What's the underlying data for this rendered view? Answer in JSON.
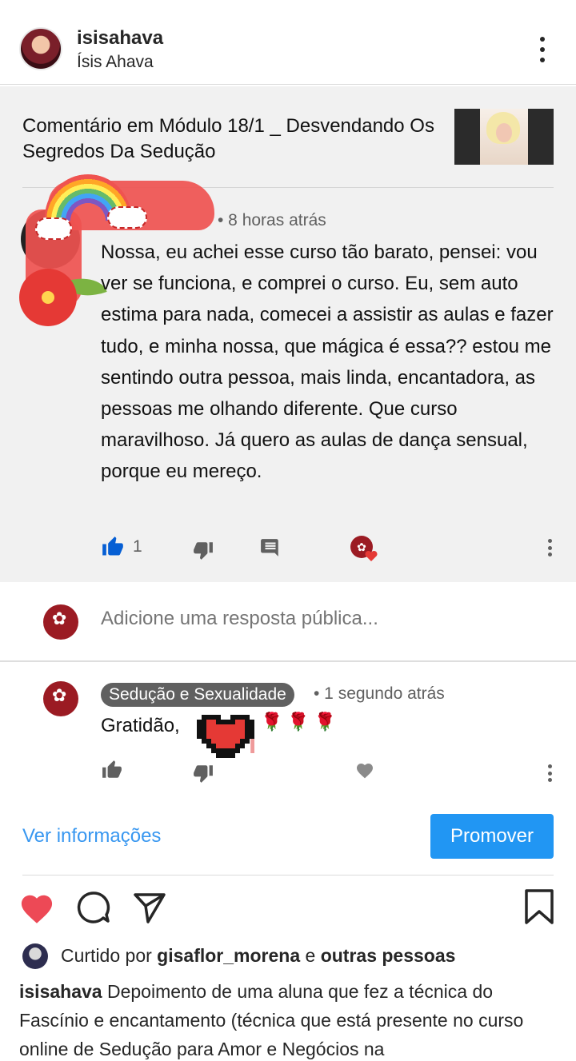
{
  "header": {
    "username": "isisahava",
    "full_name": "Ísis Ahava"
  },
  "post": {
    "module_title": "Comentário em Módulo 18/1 _ Desvendando Os Segredos Da Sedução",
    "comment": {
      "time": "• 8 horas atrás",
      "text": "Nossa, eu achei esse curso tão barato, pensei: vou ver se funciona, e comprei o curso. Eu, sem auto estima para nada, comecei a assistir as aulas e fazer tudo, e minha nossa, que mágica é essa?? estou me sentindo outra pessoa, mais linda, encantadora, as pessoas me olhando diferente. Que curso maravilhoso. Já quero as aulas de dança sensual, porque eu mereço.",
      "like_count": "1"
    },
    "reply_input": {
      "placeholder": "Adicione uma resposta pública..."
    },
    "reply": {
      "channel": "Sedução e Sexualidade",
      "time": "• 1 segundo atrás",
      "text": "Gratidão,",
      "emoji": "🌹🌹🌹"
    }
  },
  "actions": {
    "view_info": "Ver informações",
    "promote": "Promover"
  },
  "likes": {
    "prefix": "Curtido por",
    "user": "gisaflor_morena",
    "conjunction": "e",
    "others": "outras pessoas"
  },
  "caption": {
    "username": "isisahava",
    "text": "Depoimento de uma aluna que fez a técnica do Fascínio e encantamento (técnica que está presente no curso online de Sedução para Amor e Negócios na"
  },
  "icons": {
    "more": "more-vertical-icon",
    "like": "thumbs-up-icon",
    "dislike": "thumbs-down-icon",
    "reply": "comment-icon",
    "heart": "heart-icon",
    "share": "send-icon",
    "save": "bookmark-icon"
  },
  "colors": {
    "accent_blue": "#3897f0",
    "promote_blue": "#2196f3",
    "like_red": "#ed4956",
    "youtube_blue": "#065fd4"
  }
}
